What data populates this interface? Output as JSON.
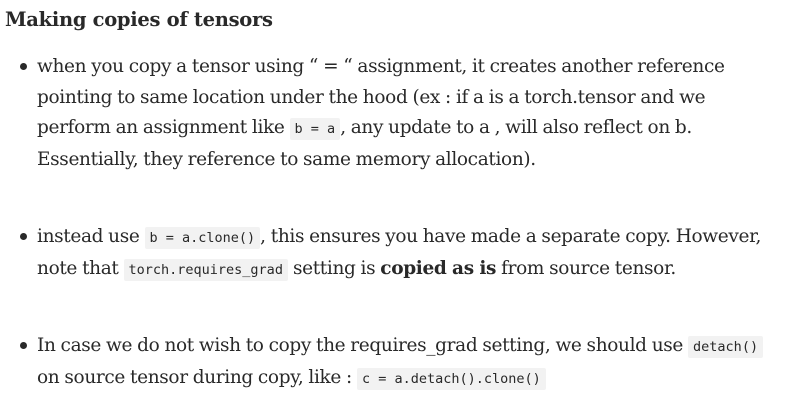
{
  "title": "Making copies of tensors",
  "points": [
    {
      "t1": "when you copy a tensor using “ = “ assignment, it creates another reference pointing to same location under the hood (ex : if a is a torch.tensor and we perform an assignment like",
      "c1": "b = a",
      "t2": ", any update to a , will also reflect on b. Essentially, they reference to same memory allocation)."
    },
    {
      "t1": "instead use",
      "c1": "b = a.clone()",
      "t2": ", this ensures you have made a separate copy. However, note that",
      "c2": "torch.requires_grad",
      "t3": "setting is",
      "bold": "copied as is",
      "t4": "from source tensor."
    },
    {
      "t1": "In case we do not wish to copy the requires_grad setting, we should use",
      "c1": "detach()",
      "t2": "on source tensor during copy, like :",
      "c2": "c = a.detach().clone()"
    }
  ]
}
